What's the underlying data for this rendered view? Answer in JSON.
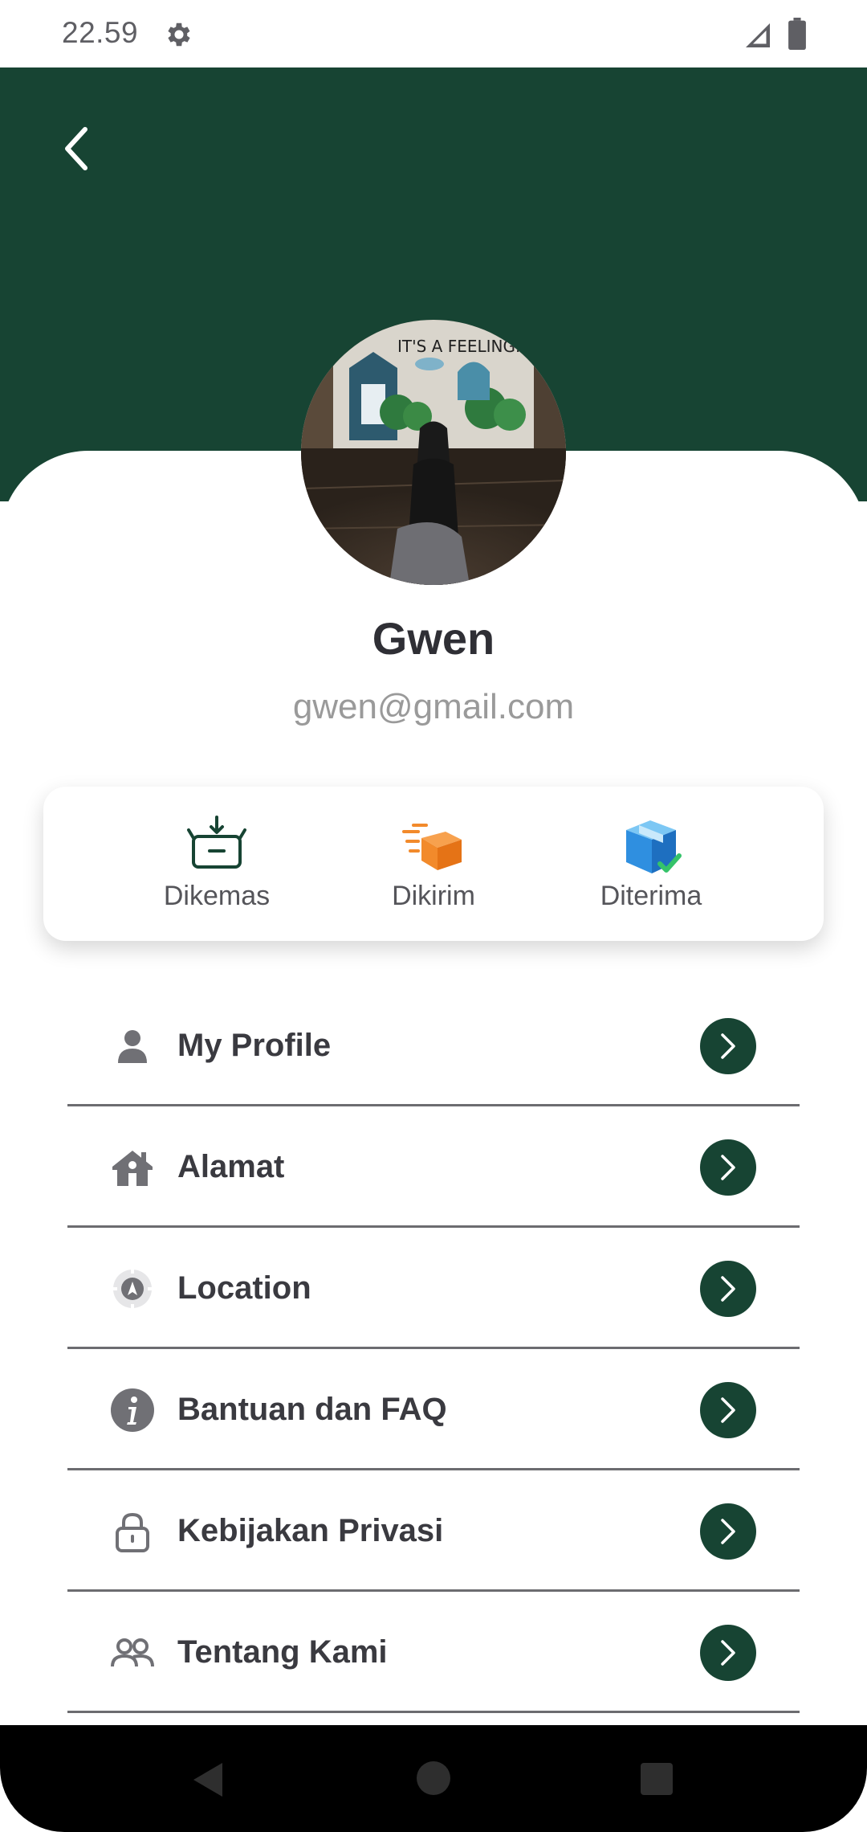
{
  "status_bar": {
    "time": "22.59",
    "icons": [
      "gear-icon",
      "signal-icon",
      "battery-icon"
    ]
  },
  "header": {
    "back_icon": "chevron-left-icon",
    "color": "#174433"
  },
  "profile": {
    "name": "Gwen",
    "email": "gwen@gmail.com",
    "avatar_text": "IT'S A FEELING."
  },
  "order_status": [
    {
      "label": "Dikemas",
      "icon": "package-download-icon",
      "color": "#174433"
    },
    {
      "label": "Dikirim",
      "icon": "shipping-box-icon",
      "color": "#f28a2b"
    },
    {
      "label": "Diterima",
      "icon": "received-box-icon",
      "color": "#2f8fe0"
    }
  ],
  "menu": [
    {
      "label": "My Profile",
      "icon": "person-icon"
    },
    {
      "label": "Alamat",
      "icon": "house-icon"
    },
    {
      "label": "Location",
      "icon": "location-icon"
    },
    {
      "label": "Bantuan dan FAQ",
      "icon": "info-icon"
    },
    {
      "label": "Kebijakan Privasi",
      "icon": "lock-icon"
    },
    {
      "label": "Tentang Kami",
      "icon": "people-icon"
    }
  ],
  "nav_bar": {
    "icons": [
      "nav-back-icon",
      "nav-home-icon",
      "nav-recents-icon"
    ]
  },
  "colors": {
    "primary": "#174433",
    "text": "#2f2f35",
    "email": "#9a9a9a"
  }
}
